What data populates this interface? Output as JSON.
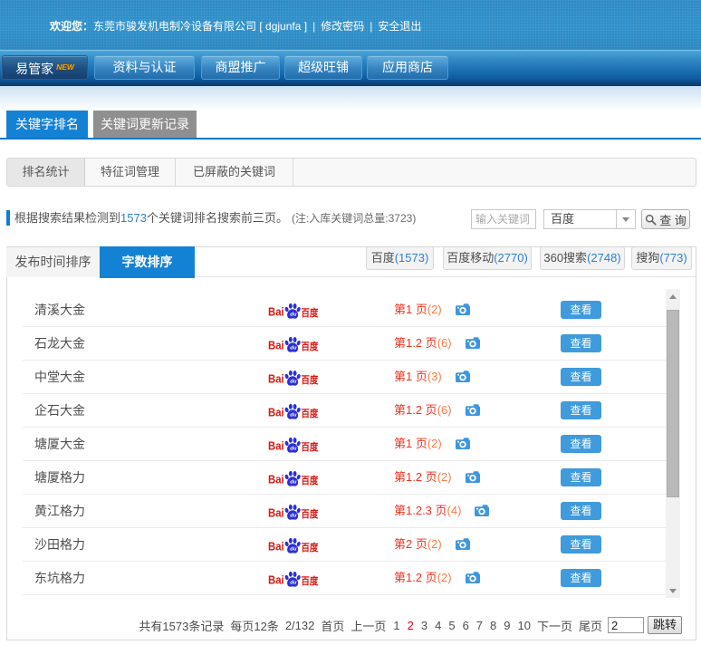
{
  "welcome_bar": {
    "greeting": "欢迎您：",
    "company": "东莞市骏发机电制冷设备有限公司 [ dgjunfa ]",
    "divider": "|",
    "change_password": "修改密码",
    "logout": "安全退出"
  },
  "main_nav": {
    "items": [
      {
        "label": "易管家",
        "badge": "NEW",
        "active": true
      },
      {
        "label": "资料与认证"
      },
      {
        "label": "商盟推广"
      },
      {
        "label": "超级旺铺"
      },
      {
        "label": "应用商店"
      }
    ]
  },
  "page_tabs": {
    "items": [
      {
        "label": "关键字排名",
        "active": true
      },
      {
        "label": "关键词更新记录",
        "active": false
      }
    ]
  },
  "sub_tabs": {
    "items": [
      {
        "label": "排名统计",
        "active": true
      },
      {
        "label": "特征词管理",
        "active": false
      },
      {
        "label": "已屏蔽的关键词",
        "active": false
      }
    ]
  },
  "summary": {
    "prefix": "根据搜索结果检测到",
    "count": "1573",
    "suffix": "个关键词排名搜索前三页。",
    "note": "(注:入库关键词总量:3723)"
  },
  "search": {
    "placeholder": "输入关键词",
    "engine_selected": "百度",
    "button_label": "查 询"
  },
  "sort_tabs": {
    "items": [
      {
        "label": "发布时间排序",
        "active": false
      },
      {
        "label": "字数排序",
        "active": true
      }
    ]
  },
  "engine_links": [
    {
      "name": "百度",
      "count": "(1573)"
    },
    {
      "name": "百度移动",
      "count": "(2770)"
    },
    {
      "name": "360搜索",
      "count": "(2748)"
    },
    {
      "name": "搜狗",
      "count": "(773)"
    }
  ],
  "baidu_logo": {
    "latin": "Bai",
    "du": "du",
    "cjk": "百度"
  },
  "table": {
    "view_label": "查看",
    "rows": [
      {
        "keyword": "清溪大金",
        "rank_pages": "第1 页",
        "rank_count": "(2)"
      },
      {
        "keyword": "石龙大金",
        "rank_pages": "第1.2 页",
        "rank_count": "(6)"
      },
      {
        "keyword": "中堂大金",
        "rank_pages": "第1 页",
        "rank_count": "(3)"
      },
      {
        "keyword": "企石大金",
        "rank_pages": "第1.2 页",
        "rank_count": "(6)"
      },
      {
        "keyword": "塘厦大金",
        "rank_pages": "第1 页",
        "rank_count": "(2)"
      },
      {
        "keyword": "塘厦格力",
        "rank_pages": "第1.2 页",
        "rank_count": "(2)"
      },
      {
        "keyword": "黄江格力",
        "rank_pages": "第1.2.3 页",
        "rank_count": "(4)"
      },
      {
        "keyword": "沙田格力",
        "rank_pages": "第2 页",
        "rank_count": "(2)"
      },
      {
        "keyword": "东坑格力",
        "rank_pages": "第1.2 页",
        "rank_count": "(2)"
      }
    ]
  },
  "pagination": {
    "total": "共有1573条记录",
    "per_page": "每页12条",
    "page_indicator": "2/132",
    "first": "首页",
    "prev": "上一页",
    "pages": [
      "1",
      "2",
      "3",
      "4",
      "5",
      "6",
      "7",
      "8",
      "9",
      "10"
    ],
    "current_page": "2",
    "next": "下一页",
    "last": "尾页",
    "jump_value": "2",
    "jump_label": "跳转"
  }
}
